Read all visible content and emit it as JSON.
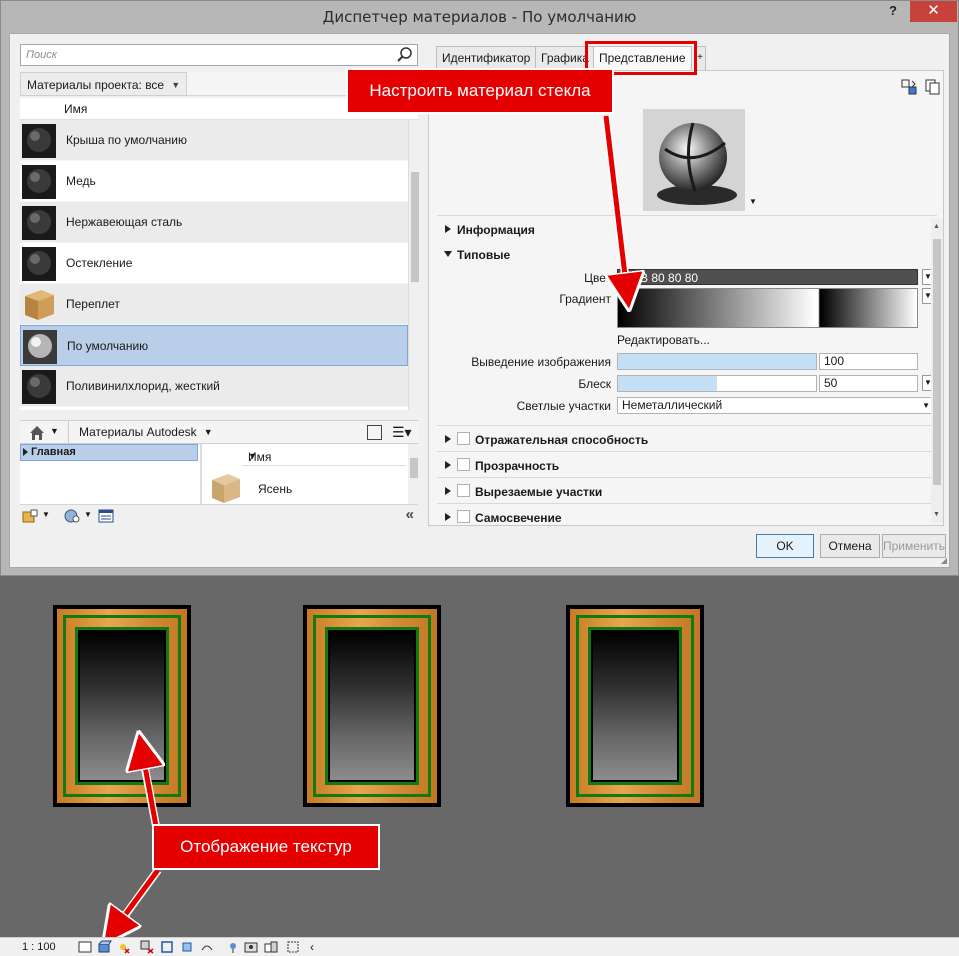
{
  "window": {
    "title": "Диспетчер материалов - По умолчанию",
    "help_label": "?",
    "close_label": "✕"
  },
  "left_panel": {
    "search_placeholder": "Поиск",
    "filter_label": "Материалы проекта: все",
    "column_name": "Имя",
    "materials": [
      {
        "name": "Крыша по умолчанию",
        "thumb": "dark-sphere"
      },
      {
        "name": "Медь",
        "thumb": "dark-sphere"
      },
      {
        "name": "Нержавеющая сталь",
        "thumb": "dark-sphere"
      },
      {
        "name": "Остекление",
        "thumb": "dark-sphere"
      },
      {
        "name": "Переплет",
        "thumb": "wood-cube"
      },
      {
        "name": "По умолчанию",
        "thumb": "grey-sphere"
      },
      {
        "name": "Поливинилхлорид, жесткий",
        "thumb": "dark-sphere"
      }
    ],
    "selected_index": 5,
    "library_label": "Материалы Autodesk",
    "library_tree_node": "Главная",
    "library_column": "Имя",
    "library_items": [
      {
        "name": "Ясень",
        "thumb": "wood-cube"
      }
    ],
    "collapse_label": "«"
  },
  "right_panel": {
    "tabs": [
      {
        "label": "Идентификатор",
        "active": false
      },
      {
        "label": "Графика",
        "active": false
      },
      {
        "label": "Представление",
        "active": true
      },
      {
        "label": "+",
        "active": false
      }
    ],
    "toolbar_icons": [
      "replace-asset-icon",
      "duplicate-asset-icon"
    ],
    "sections": {
      "info": "Информация",
      "generic": "Типовые",
      "reflectivity": "Отражательная способность",
      "transparency": "Прозрачность",
      "cutouts": "Вырезаемые участки",
      "self_illum": "Самосвечение"
    },
    "props": {
      "color_label": "Цвет",
      "color_value": "RGB 80 80 80",
      "gradient_label": "Градиент",
      "edit_link": "Редактировать...",
      "image_fade_label": "Выведение изображения",
      "image_fade_value": "100",
      "image_fade_fraction": 1.0,
      "glossiness_label": "Блеск",
      "glossiness_value": "50",
      "glossiness_fraction": 0.5,
      "highlights_label": "Светлые участки",
      "highlights_value": "Неметаллический"
    }
  },
  "buttons": {
    "ok": "OK",
    "cancel": "Отмена",
    "apply": "Применить"
  },
  "callouts": {
    "top": "Настроить материал стекла",
    "bottom": "Отображение текстур"
  },
  "statusbar": {
    "scale": "1 : 100"
  },
  "colors": {
    "accent_red": "#e40000",
    "selection_blue": "#b9cfe9",
    "frame_green": "#127a12",
    "wood": "#d38a36"
  }
}
